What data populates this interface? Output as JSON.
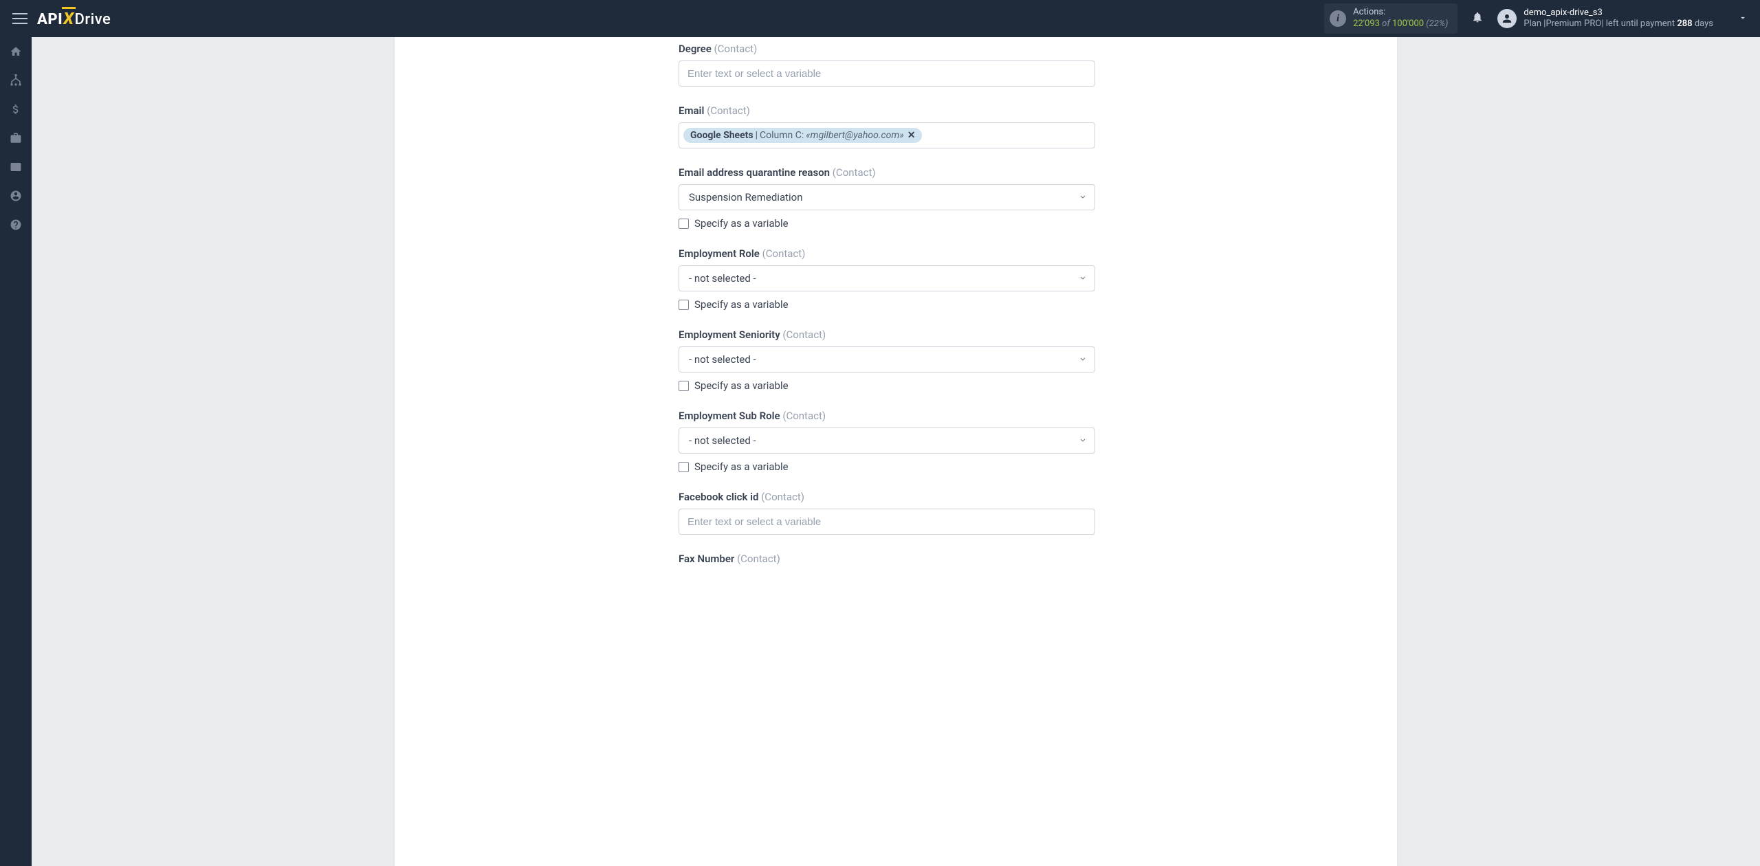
{
  "header": {
    "logo_part1": "API",
    "logo_part2": "X",
    "logo_part3": "Drive",
    "actions_label": "Actions:",
    "actions_used": "22'093",
    "actions_of": "of",
    "actions_total": "100'000",
    "actions_pct": "(22%)",
    "user_name": "demo_apix-drive_s3",
    "plan_prefix": "Plan |",
    "plan_name": "Premium PRO",
    "plan_mid": "| left until payment ",
    "plan_days": "288",
    "plan_suffix": " days"
  },
  "form": {
    "variable_placeholder": "Enter text or select a variable",
    "not_selected": "- not selected -",
    "specify_variable": "Specify as a variable",
    "contact_sub": "(Contact)",
    "degree_label": "Degree ",
    "email_label": "Email ",
    "email_tag_source": "Google Sheets",
    "email_tag_pipe": " | ",
    "email_tag_column": "Column C: ",
    "email_tag_value": "«mgilbert@yahoo.com»",
    "quarantine_label": "Email address quarantine reason ",
    "quarantine_value": "Suspension Remediation",
    "emp_role_label": "Employment Role ",
    "emp_seniority_label": "Employment Seniority ",
    "emp_subrole_label": "Employment Sub Role ",
    "fb_click_label": "Facebook click id ",
    "fax_label": "Fax Number "
  }
}
